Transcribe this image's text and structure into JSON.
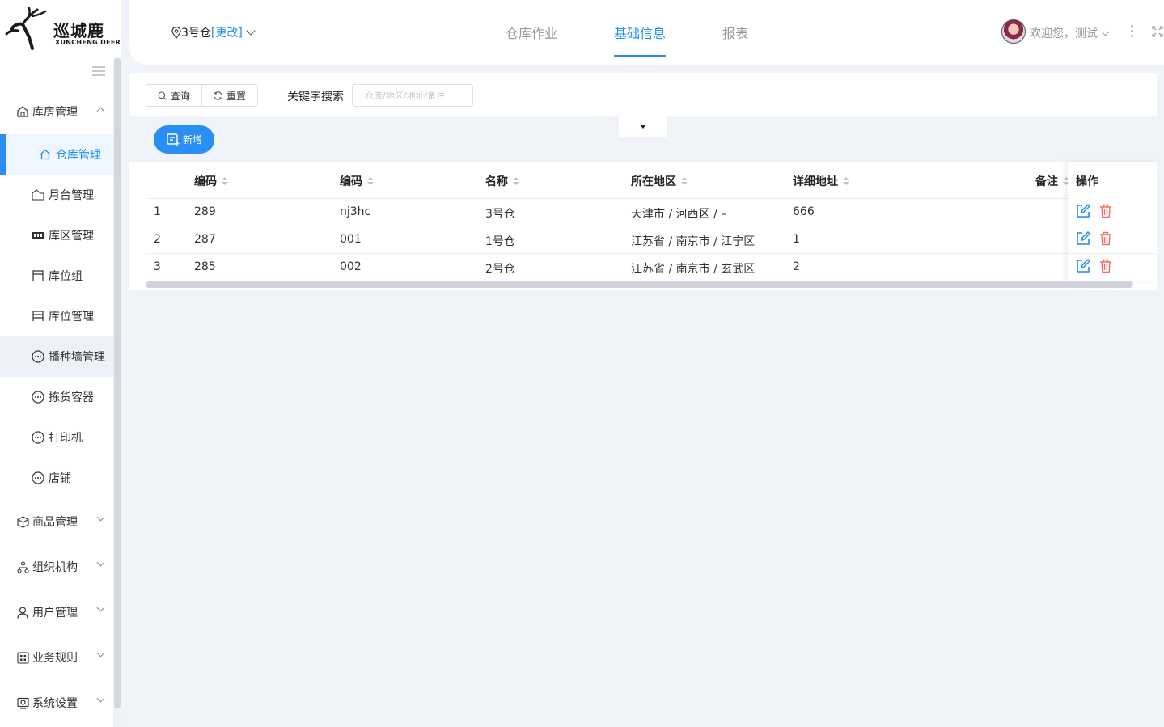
{
  "logo": {
    "cn": "巡城鹿",
    "en": "XUNCHENG DEER"
  },
  "header": {
    "warehouse": "3号仓",
    "change_label": "[更改]",
    "tabs": [
      {
        "label": "仓库作业"
      },
      {
        "label": "基础信息"
      },
      {
        "label": "报表"
      }
    ],
    "active_tab": "基础信息",
    "welcome": "欢迎您，测试"
  },
  "sidebar": {
    "groups": [
      {
        "label": "库房管理",
        "expanded": true
      },
      {
        "label": "商品管理"
      },
      {
        "label": "组织机构"
      },
      {
        "label": "用户管理"
      },
      {
        "label": "业务规则"
      },
      {
        "label": "系统设置"
      }
    ],
    "items": [
      {
        "label": "仓库管理",
        "active": true
      },
      {
        "label": "月台管理"
      },
      {
        "label": "库区管理"
      },
      {
        "label": "库位组"
      },
      {
        "label": "库位管理"
      },
      {
        "label": "播种墙管理"
      },
      {
        "label": "拣货容器"
      },
      {
        "label": "打印机"
      },
      {
        "label": "店铺"
      }
    ]
  },
  "search": {
    "query_label": "查询",
    "reset_label": "重置",
    "keyword_label": "关键字搜索",
    "keyword_placeholder": "仓库/地区/地址/备注"
  },
  "add_label": "新增",
  "table": {
    "columns": [
      "编码",
      "编码",
      "名称",
      "所在地区",
      "详细地址",
      "备注"
    ],
    "ops_label": "操作",
    "rows": [
      {
        "idx": "1",
        "id": "289",
        "code": "nj3hc",
        "name": "3号仓",
        "region": "天津市 / 河西区 / –",
        "address": "666",
        "remark": ""
      },
      {
        "idx": "2",
        "id": "287",
        "code": "001",
        "name": "1号仓",
        "region": "江苏省 / 南京市 / 江宁区",
        "address": "1",
        "remark": ""
      },
      {
        "idx": "3",
        "id": "285",
        "code": "002",
        "name": "2号仓",
        "region": "江苏省 / 南京市 / 玄武区",
        "address": "2",
        "remark": ""
      }
    ]
  },
  "colors": {
    "accent": "#1e8cf0",
    "danger": "#f56c6c"
  }
}
